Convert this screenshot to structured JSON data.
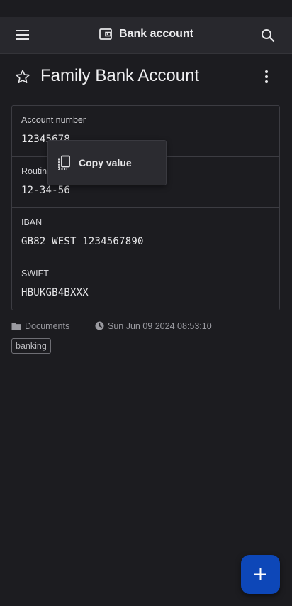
{
  "header": {
    "title": "Bank account",
    "menu_icon": "hamburger-menu-icon",
    "type_icon": "wallet-icon",
    "search_icon": "search-icon"
  },
  "entry": {
    "name": "Family Bank Account",
    "favorite": false
  },
  "fields": [
    {
      "label": "Account number",
      "value": "12345678"
    },
    {
      "label": "Routing",
      "value": "12-34-56"
    },
    {
      "label": "IBAN",
      "value": "GB82 WEST 1234567890"
    },
    {
      "label": "SWIFT",
      "value": "HBUKGB4BXXX"
    }
  ],
  "popup": {
    "copy_label": "Copy value"
  },
  "meta": {
    "folder": "Documents",
    "modified": "Sun Jun 09 2024 08:53:10"
  },
  "tags": [
    "banking"
  ],
  "colors": {
    "background": "#1c1c20",
    "app_bar": "#28282d",
    "fab": "#0d47b8"
  }
}
